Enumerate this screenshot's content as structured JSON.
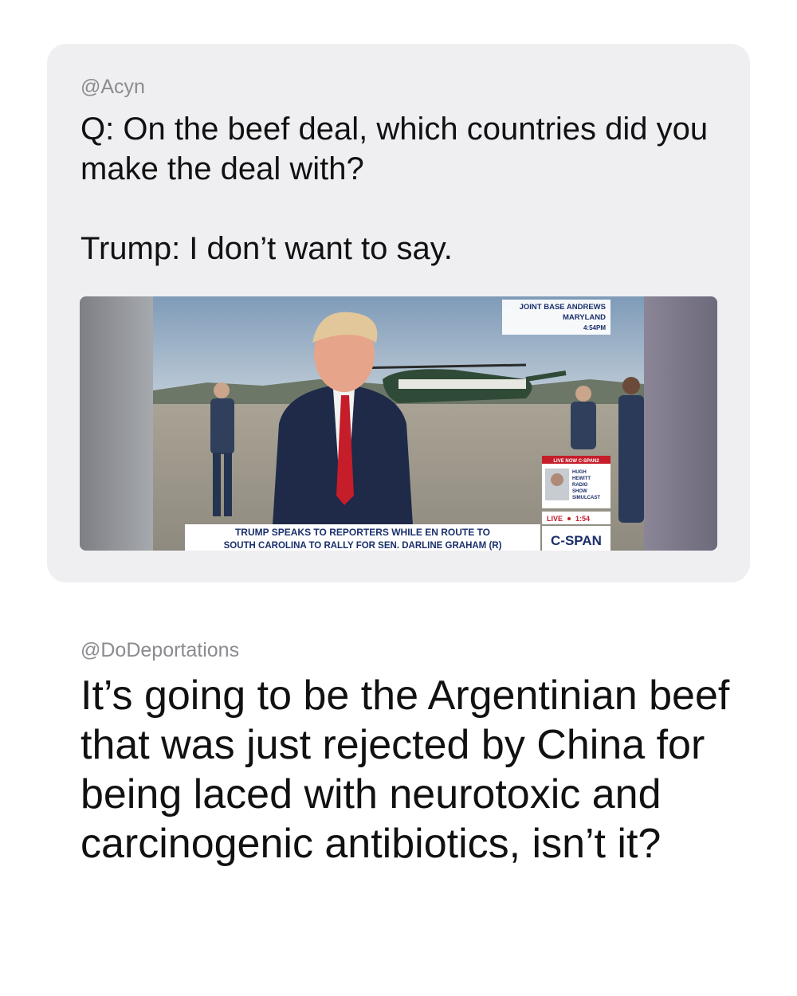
{
  "quoted_post": {
    "handle": "@Acyn",
    "text": "Q: On the beef deal, which countries did you make the deal with?\n\nTrump: I don’t want to say.",
    "video": {
      "location_line1": "JOINT BASE ANDREWS",
      "location_line2": "MARYLAND",
      "location_time": "4:54PM",
      "live_now_label": "LIVE NOW C-SPAN2",
      "inset_label_1": "HUGH",
      "inset_label_2": "HEWITT",
      "inset_label_3": "RADIO",
      "inset_label_4": "SHOW",
      "inset_label_5": "SIMULCAST",
      "live_badge": "LIVE",
      "live_time": "1:54",
      "chyron_line1": "TRUMP SPEAKS TO REPORTERS WHILE EN ROUTE TO",
      "chyron_line2": "SOUTH CAROLINA TO RALLY FOR SEN. DARLINE GRAHAM (R)",
      "network_logo": "C-SPAN"
    }
  },
  "reply_post": {
    "handle": "@DoDeportations",
    "text": "It’s going to be the Argentinian beef that was just rejected by China for being laced with neurotoxic and carcinogenic antibiotics, isn’t it?"
  }
}
